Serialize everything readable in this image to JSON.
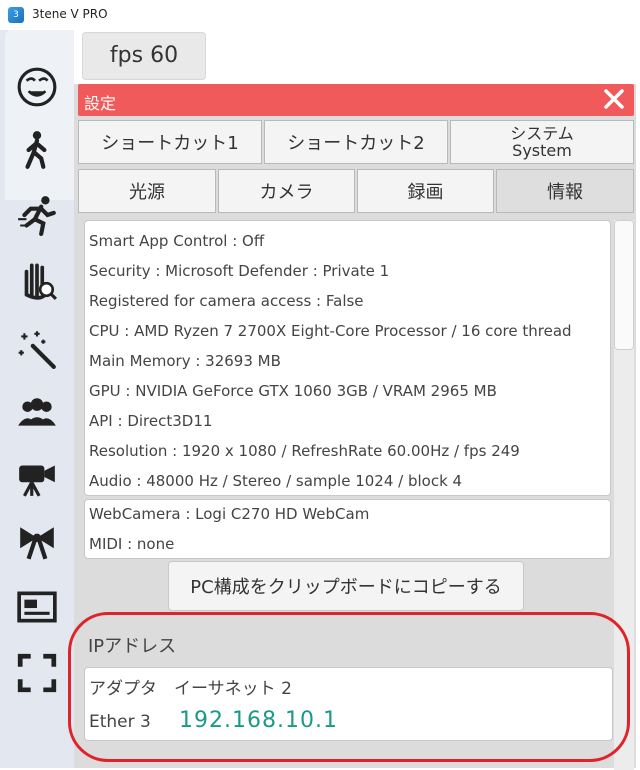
{
  "window": {
    "title": "3tene V PRO"
  },
  "fps": {
    "label": "fps  60"
  },
  "sidebar": {
    "icons": [
      "face-icon",
      "walk-icon",
      "run-icon",
      "hand-search-icon",
      "magic-wand-icon",
      "group-icon",
      "camera-icon",
      "bow-icon",
      "card-icon",
      "fullscreen-icon"
    ]
  },
  "dialog": {
    "title": "設定",
    "tabs_row1": [
      "ショートカット1",
      "ショートカット2"
    ],
    "system_tab": {
      "line1": "システム",
      "line2": "System"
    },
    "tabs_row2": [
      "光源",
      "カメラ",
      "録画",
      "情報"
    ],
    "active_tab": "情報"
  },
  "info": {
    "lines": [
      "Smart App Control : Off",
      "Security : Microsoft Defender : Private 1",
      "Registered for camera access : False",
      "CPU : AMD Ryzen 7 2700X Eight-Core Processor  / 16 core thread",
      "Main Memory : 32693 MB",
      "GPU : NVIDIA GeForce GTX 1060 3GB / VRAM 2965 MB",
      "API : Direct3D11",
      "Resolution : 1920 x 1080 / RefreshRate 60.00Hz / fps 249",
      "Audio : 48000 Hz / Stereo / sample 1024 / block 4"
    ],
    "devices": [
      "WebCamera : Logi C270 HD WebCam",
      "MIDI : none"
    ]
  },
  "copy_button": {
    "label": "PC構成をクリップボードにコピーする"
  },
  "ip": {
    "title": "IPアドレス",
    "adapter": "アダプタ　イーサネット 2",
    "name": "Ether 3",
    "address": "192.168.10.1",
    "address_color": "#1a9a86"
  },
  "colors": {
    "header": "#f05a5a",
    "highlight": "#e0232a"
  }
}
